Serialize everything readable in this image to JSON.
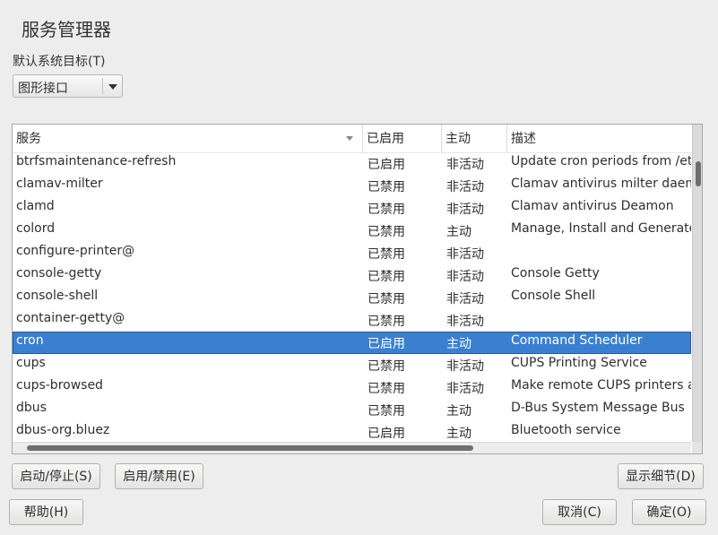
{
  "dialog": {
    "title": "服务管理器",
    "default_target_label": "默认系统目标(T)",
    "default_target_value": "图形接口"
  },
  "table": {
    "columns": [
      "服务",
      "已启用",
      "主动",
      "描述"
    ],
    "rows": [
      {
        "name": "btrfsmaintenance-refresh",
        "enabled": "已启用",
        "active": "非活动",
        "description": "Update cron periods from /etc/"
      },
      {
        "name": "clamav-milter",
        "enabled": "已禁用",
        "active": "非活动",
        "description": "Clamav antivirus milter daemon"
      },
      {
        "name": "clamd",
        "enabled": "已禁用",
        "active": "非活动",
        "description": "Clamav antivirus Deamon"
      },
      {
        "name": "colord",
        "enabled": "已禁用",
        "active": "主动",
        "description": "Manage, Install and Generate C"
      },
      {
        "name": "configure-printer@",
        "enabled": "已禁用",
        "active": "非活动",
        "description": ""
      },
      {
        "name": "console-getty",
        "enabled": "已禁用",
        "active": "非活动",
        "description": "Console Getty"
      },
      {
        "name": "console-shell",
        "enabled": "已禁用",
        "active": "非活动",
        "description": "Console Shell"
      },
      {
        "name": "container-getty@",
        "enabled": "已禁用",
        "active": "非活动",
        "description": ""
      },
      {
        "name": "cron",
        "enabled": "已启用",
        "active": "主动",
        "description": "Command Scheduler",
        "selected": true
      },
      {
        "name": "cups",
        "enabled": "已禁用",
        "active": "非活动",
        "description": "CUPS Printing Service"
      },
      {
        "name": "cups-browsed",
        "enabled": "已禁用",
        "active": "非活动",
        "description": "Make remote CUPS printers av"
      },
      {
        "name": "dbus",
        "enabled": "已禁用",
        "active": "主动",
        "description": "D-Bus System Message Bus"
      },
      {
        "name": "dbus-org.bluez",
        "enabled": "已启用",
        "active": "主动",
        "description": "Bluetooth service"
      }
    ]
  },
  "buttons": {
    "start_stop": "启动/停止(S)",
    "enable_disable": "启用/禁用(E)",
    "show_details": "显示细节(D)",
    "help": "帮助(H)",
    "cancel": "取消(C)",
    "ok": "确定(O)"
  },
  "colors": {
    "selection": "#3b80d0",
    "background": "#ededed"
  }
}
